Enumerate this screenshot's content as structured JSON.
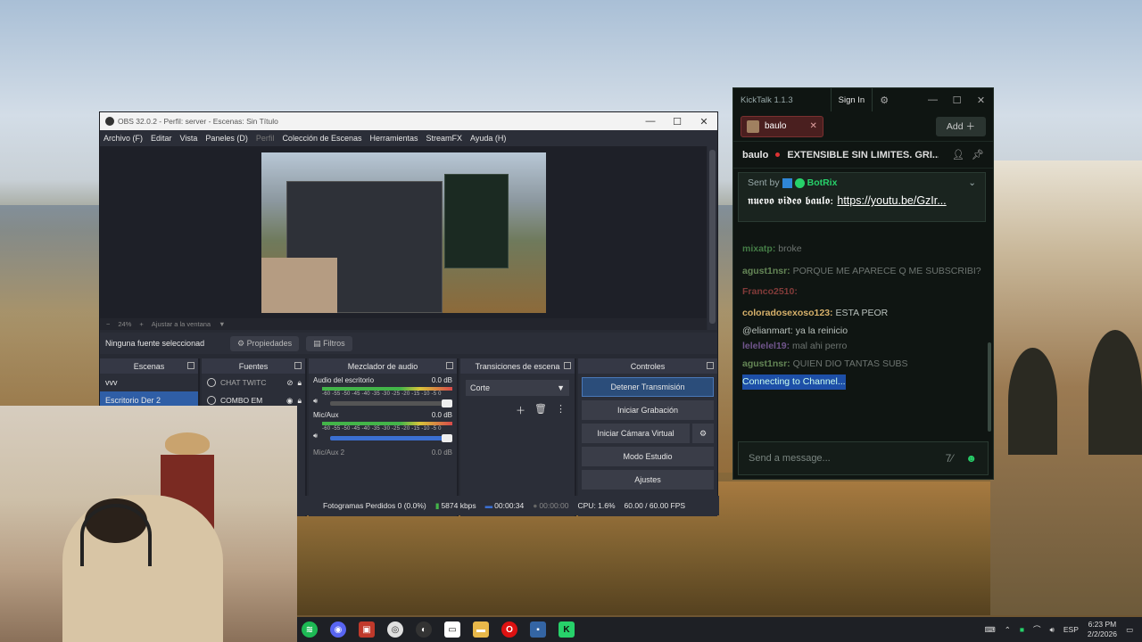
{
  "obs": {
    "title": "OBS 32.0.2 - Perfil: server - Escenas: Sin Título",
    "menu": [
      "Archivo (F)",
      "Editar",
      "Vista",
      "Paneles (D)",
      "Perfil",
      "Colección de Escenas",
      "Herramientas",
      "StreamFX",
      "Ayuda (H)"
    ],
    "zoom": "24%",
    "fit_label": "Ajustar a la ventana",
    "no_source": "Ninguna fuente seleccionad",
    "properties_label": "Propiedades",
    "filters_label": "Filtros",
    "docks": {
      "scenes": "Escenas",
      "sources": "Fuentes",
      "mixer": "Mezclador de audio",
      "transitions": "Transiciones de escena",
      "controls": "Controles"
    },
    "scenes": [
      "vvv",
      "Escritorio Der 2"
    ],
    "sources": [
      "CHAT TWITC",
      "COMBO EM"
    ],
    "mixer": [
      {
        "name": "Audio del escritorio",
        "db": "0.0 dB"
      },
      {
        "name": "Mic/Aux",
        "db": "0.0 dB"
      },
      {
        "name": "Mic/Aux 2",
        "db": "0.0 dB"
      }
    ],
    "meter_ticks": "-60 -55 -50 -45 -40 -35 -30 -25 -20 -15 -10 -5 0",
    "transition": "Corte",
    "controls": [
      "Detener Transmisión",
      "Iniciar Grabación",
      "Iniciar Cámara Virtual",
      "Modo Estudio",
      "Ajustes"
    ],
    "status": {
      "dropped": "Fotogramas Perdidos 0 (0.0%)",
      "kbps": "5874 kbps",
      "live_time": "00:00:34",
      "rec_time": "00:00:00",
      "cpu": "CPU: 1.6%",
      "fps": "60.00 / 60.00 FPS"
    }
  },
  "kicktalk": {
    "title": "KickTalk 1.1.3",
    "sign_in": "Sign In",
    "tab": "baulo",
    "add": "Add",
    "channel": "baulo",
    "stream_title": "EXTENSIBLE SIN LIMITES. GRI...",
    "pinned": {
      "sent_by": "Sent by",
      "bot": "BotRix",
      "text": "𝖓𝖚𝖊𝖛𝖔 𝖛𝖎𝖉𝖊𝖔 𝖇𝖆𝖚𝖑𝖔:",
      "link": "https://youtu.be/GzIr..."
    },
    "messages": [
      {
        "user": "mixatp:",
        "text": "broke"
      },
      {
        "user": "agust1nsr:",
        "text": "PORQUE ME APARECE Q ME SUBSCRIBI?"
      },
      {
        "user": "Franco2510:",
        "text": ""
      },
      {
        "user": "coloradosexoso123:",
        "text": "ESTA PEOR"
      },
      {
        "user": "@elianmart:",
        "text": "ya la reinicio"
      },
      {
        "user": "lelelelel19:",
        "text": "mal ahi perro"
      },
      {
        "user": "agust1nsr:",
        "text": "QUIEN DIO TANTAS SUBS"
      }
    ],
    "connecting": "Connecting to Channel...",
    "input_placeholder": "Send a message..."
  },
  "taskbar": {
    "lang": "ESP",
    "time": "6:23 PM",
    "date": "2/2/2026"
  },
  "colors": {
    "kick_green": "#27d16a",
    "obs_bg": "#272a33",
    "obs_blue": "#2f5ea6"
  }
}
